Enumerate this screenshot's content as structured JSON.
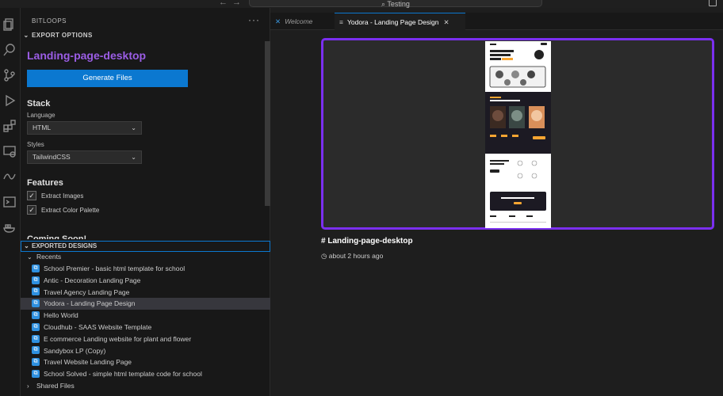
{
  "window": {
    "command_center": "Testing"
  },
  "sidebar": {
    "title": "BITLOOPS",
    "more": "···",
    "export_options": {
      "header": "EXPORT OPTIONS",
      "project_title": "Landing-page-desktop",
      "generate_button": "Generate Files",
      "stack_heading": "Stack",
      "language_label": "Language",
      "language_value": "HTML",
      "styles_label": "Styles",
      "styles_value": "TailwindCSS",
      "features_heading": "Features",
      "features": [
        {
          "label": "Extract Images",
          "checked": true
        },
        {
          "label": "Extract Color Palette",
          "checked": true
        }
      ],
      "coming_soon": "Coming Soon!"
    },
    "exported_designs": {
      "header": "EXPORTED DESIGNS",
      "recents_label": "Recents",
      "items": [
        "School Premier - basic html template for school",
        "Antic - Decoration Landing Page",
        "Travel Agency Landing Page",
        "Yodora - Landing Page Design",
        "Hello World",
        "Cloudhub - SAAS Website Template",
        "E commerce Landing website for plant and flower",
        "Sandybox LP (Copy)",
        "Travel Website Landing Page",
        "School Solved - simple html template code for school"
      ],
      "selected_index": 3,
      "shared_label": "Shared Files"
    }
  },
  "editor": {
    "tabs": [
      {
        "label": "Welcome",
        "active": false
      },
      {
        "label": "Yodora - Landing Page Design",
        "active": true
      }
    ],
    "page_name": "# Landing-page-desktop",
    "timestamp": "about 2 hours ago"
  },
  "colors": {
    "accent": "#0b78d0",
    "frame": "#7b2ff0",
    "title_purple": "#9b5de5"
  }
}
